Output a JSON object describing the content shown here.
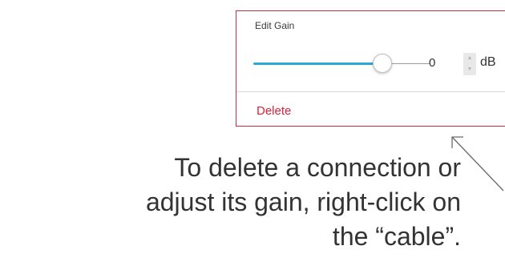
{
  "popup": {
    "title": "Edit Gain",
    "gain": {
      "value": "0",
      "unit": "dB",
      "slider_fraction": 0.73
    },
    "stepper": {
      "up_icon": "triangle-up",
      "down_icon": "triangle-down"
    },
    "delete_label": "Delete",
    "colors": {
      "border": "#c0303f",
      "slider_fill": "#2aa9d6",
      "delete_text": "#e0203a"
    }
  },
  "caption": {
    "line1": "To delete a connection or",
    "line2": "adjust its gain, right-click on",
    "line3": "the “cable”."
  },
  "pointer": {
    "icon": "arrow-pointer-icon"
  }
}
